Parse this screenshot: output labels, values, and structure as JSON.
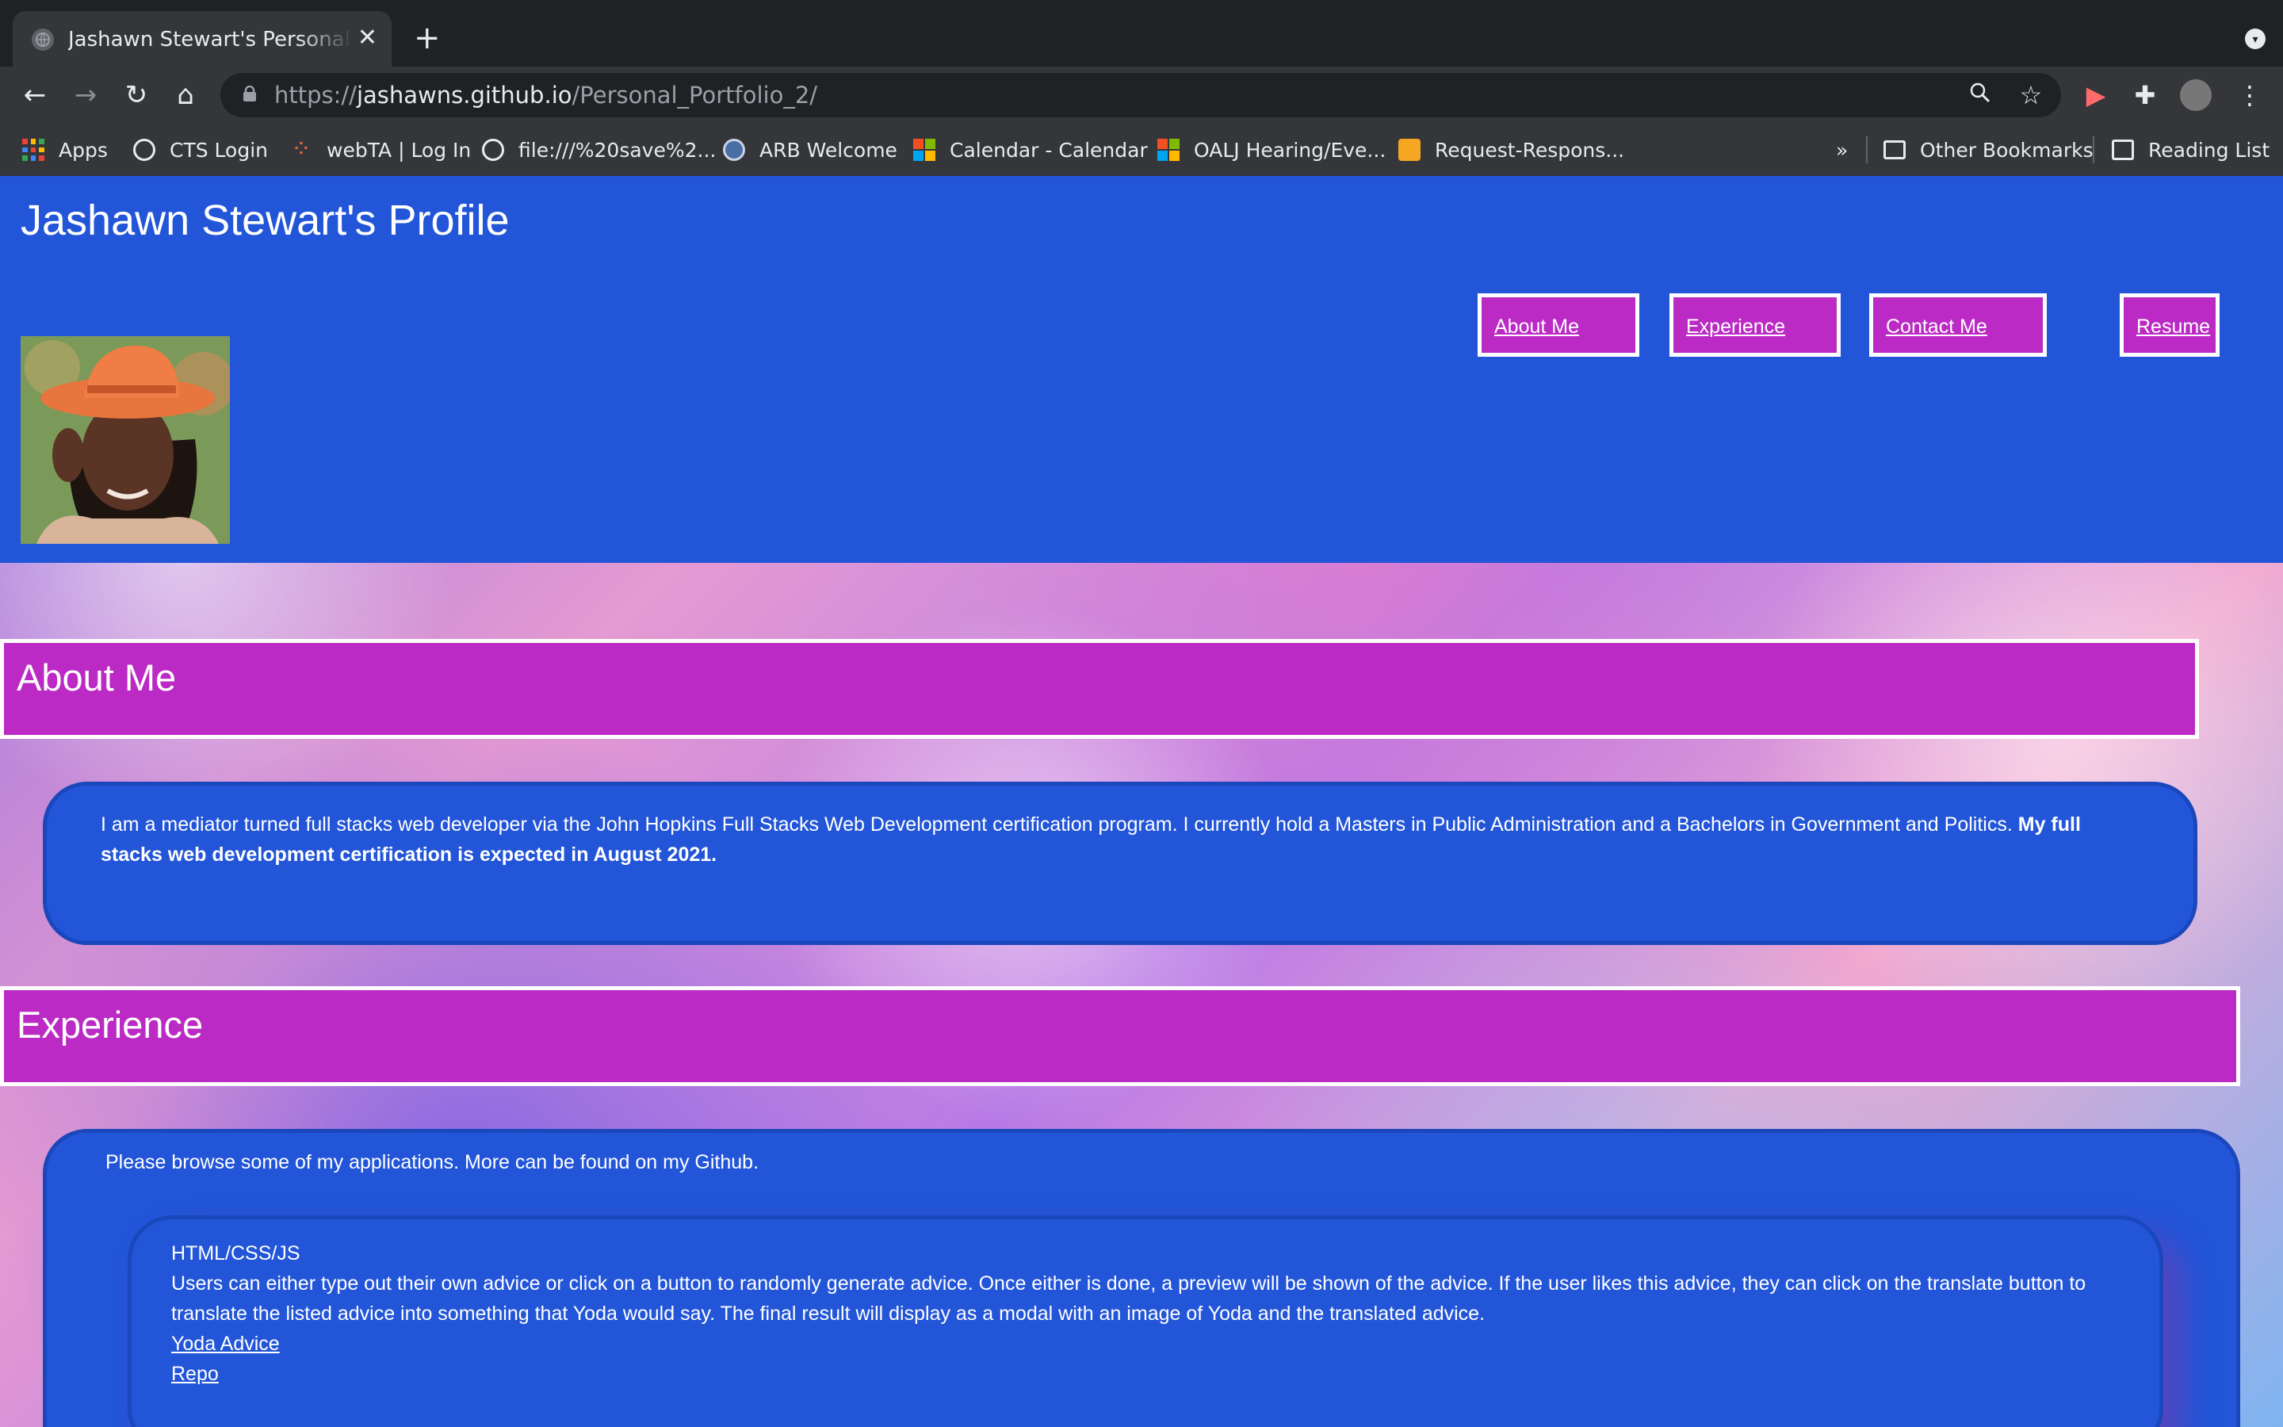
{
  "browser": {
    "tab_title": "Jashawn Stewart's Personal Portfolio",
    "url_scheme": "https://",
    "url_host": "jashawns.github.io",
    "url_path": "/Personal_Portfolio_2/",
    "bookmarks": [
      {
        "label": "Apps",
        "icon": "apps-grid-icon"
      },
      {
        "label": "CTS Login",
        "icon": "globe-icon"
      },
      {
        "label": "webTA | Log In",
        "icon": "webta-icon"
      },
      {
        "label": "file:///%20save%2...",
        "icon": "globe-icon"
      },
      {
        "label": "ARB Welcome",
        "icon": "arb-icon"
      },
      {
        "label": "Calendar - Calendar",
        "icon": "microsoft-icon"
      },
      {
        "label": "OALJ Hearing/Eve...",
        "icon": "microsoft-icon"
      },
      {
        "label": "Request-Respons...",
        "icon": "fs-icon"
      }
    ],
    "overflow_label": "»",
    "other_bookmarks": "Other Bookmarks",
    "reading_list": "Reading List"
  },
  "site": {
    "title": "Jashawn Stewart's Profile",
    "nav": [
      "About Me",
      "Experience",
      "Contact Me",
      "Resume"
    ],
    "accent_color": "#bb2ac4",
    "header_color": "#2255d8"
  },
  "about": {
    "heading": "About Me",
    "text": "I am a mediator turned full stacks web developer via the John Hopkins Full Stacks Web Development certification program. I currently hold a Masters in Public Administration and a Bachelors in Government and Politics.",
    "bold_text": "My full stacks web development certification is expected in August 2021."
  },
  "experience": {
    "heading": "Experience",
    "intro": "Please browse some of my applications. More can be found on my Github.",
    "projects": [
      {
        "tech": "HTML/CSS/JS",
        "description": "Users can either type out their own advice or click on a button to randomly generate advice. Once either is done, a preview will be shown of the advice. If the user likes this advice, they can click on the translate button to translate the listed advice into something that Yoda would say. The final result will display as a modal with an image of Yoda and the translated advice.",
        "link_label": "Yoda Advice",
        "repo_label": "Repo"
      }
    ]
  }
}
